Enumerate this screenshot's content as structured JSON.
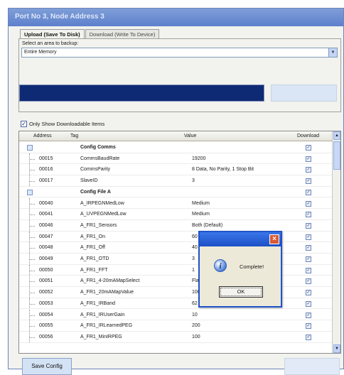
{
  "window": {
    "title": "Port No 3, Node Address 3"
  },
  "tabs": [
    {
      "label": "Upload (Save To Disk)",
      "active": true
    },
    {
      "label": "Download (Write To Device)",
      "active": false
    }
  ],
  "area": {
    "label": "Select an area to backup:",
    "selected": "Entire Memory"
  },
  "progress": {
    "fraction": 1.0,
    "color": "#0f2a74"
  },
  "upload_button": {
    "label": ""
  },
  "filter": {
    "label": "Only Show Downloadable Items",
    "checked": true
  },
  "grid": {
    "columns": [
      "Address",
      "Tag",
      "Value",
      "Download"
    ],
    "rows": [
      {
        "kind": "group",
        "address": "",
        "tag": "Config Comms",
        "value": ""
      },
      {
        "kind": "item",
        "address": "00015",
        "tag": "CommsBaudRate",
        "value": "19200"
      },
      {
        "kind": "item",
        "address": "00016",
        "tag": "CommsParity",
        "value": "8 Data, No Parity, 1 Stop Bit"
      },
      {
        "kind": "item",
        "address": "00017",
        "tag": "SlaveID",
        "value": "3"
      },
      {
        "kind": "group",
        "address": "",
        "tag": "Config File A",
        "value": ""
      },
      {
        "kind": "item",
        "address": "00040",
        "tag": "A_IRPEGNMedLow",
        "value": "Medium"
      },
      {
        "kind": "item",
        "address": "00041",
        "tag": "A_UVPEGNMedLow",
        "value": "Medium"
      },
      {
        "kind": "item",
        "address": "00046",
        "tag": "A_FR1_Sensors",
        "value": "Both (Default)"
      },
      {
        "kind": "item",
        "address": "00047",
        "tag": "A_FR1_On",
        "value": "60"
      },
      {
        "kind": "item",
        "address": "00048",
        "tag": "A_FR1_Off",
        "value": "40"
      },
      {
        "kind": "item",
        "address": "00049",
        "tag": "A_FR1_OTD",
        "value": "3"
      },
      {
        "kind": "item",
        "address": "00050",
        "tag": "A_FR1_FFT",
        "value": "1"
      },
      {
        "kind": "item",
        "address": "00051",
        "tag": "A_FR1_4-20mAMapSelect",
        "value": "Flame"
      },
      {
        "kind": "item",
        "address": "00052",
        "tag": "A_FR1_20mAMapValue",
        "value": "100"
      },
      {
        "kind": "item",
        "address": "00053",
        "tag": "A_FR1_IRBand",
        "value": "62 Hz"
      },
      {
        "kind": "item",
        "address": "00054",
        "tag": "A_FR1_IRUserGain",
        "value": "10"
      },
      {
        "kind": "item",
        "address": "00055",
        "tag": "A_FR1_IRLearnedPEG",
        "value": "200"
      },
      {
        "kind": "item",
        "address": "00056",
        "tag": "A_FR1_MinIRPEG",
        "value": "100"
      }
    ]
  },
  "footer": {
    "save_label": "Save Config",
    "exit_label": ""
  },
  "dialog": {
    "message": "Complete!",
    "ok_label": "OK",
    "close_glyph": "×",
    "info_glyph": "i"
  },
  "glyphs": {
    "check": "✓",
    "up": "▲",
    "down": "▼",
    "dropdown": "▼"
  }
}
